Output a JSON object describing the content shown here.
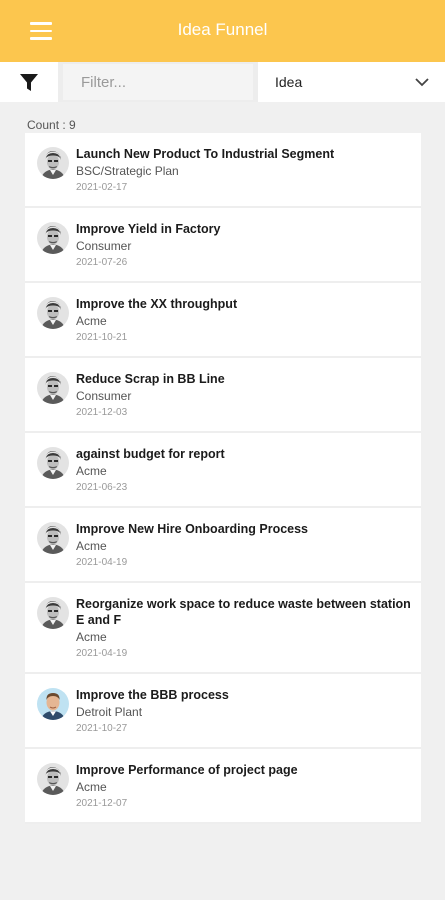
{
  "app": {
    "title": "Idea Funnel"
  },
  "filter": {
    "placeholder": "Filter...",
    "type_selected": "Idea"
  },
  "count_label": "Count : 9",
  "items": [
    {
      "title": "Launch New Product To Industrial Segment",
      "subtitle": "BSC/Strategic Plan",
      "date": "2021-02-17",
      "avatar": "gray-portrait"
    },
    {
      "title": "Improve Yield in Factory",
      "subtitle": "Consumer",
      "date": "2021-07-26",
      "avatar": "gray-portrait"
    },
    {
      "title": "Improve the XX throughput",
      "subtitle": "Acme",
      "date": "2021-10-21",
      "avatar": "gray-portrait"
    },
    {
      "title": "Reduce Scrap in BB Line",
      "subtitle": "Consumer",
      "date": "2021-12-03",
      "avatar": "gray-portrait"
    },
    {
      "title": "against budget for report",
      "subtitle": "Acme",
      "date": "2021-06-23",
      "avatar": "gray-portrait"
    },
    {
      "title": "Improve New Hire Onboarding Process",
      "subtitle": "Acme",
      "date": "2021-04-19",
      "avatar": "gray-portrait"
    },
    {
      "title": "Reorganize work space to reduce waste between station E and F",
      "subtitle": "Acme",
      "date": "2021-04-19",
      "avatar": "gray-portrait"
    },
    {
      "title": "Improve the BBB process",
      "subtitle": "Detroit Plant",
      "date": "2021-10-27",
      "avatar": "color-portrait"
    },
    {
      "title": "Improve Performance of project page",
      "subtitle": "Acme",
      "date": "2021-12-07",
      "avatar": "gray-portrait"
    }
  ],
  "colors": {
    "appbar": "#fcc64e",
    "background": "#f0f0f0"
  }
}
